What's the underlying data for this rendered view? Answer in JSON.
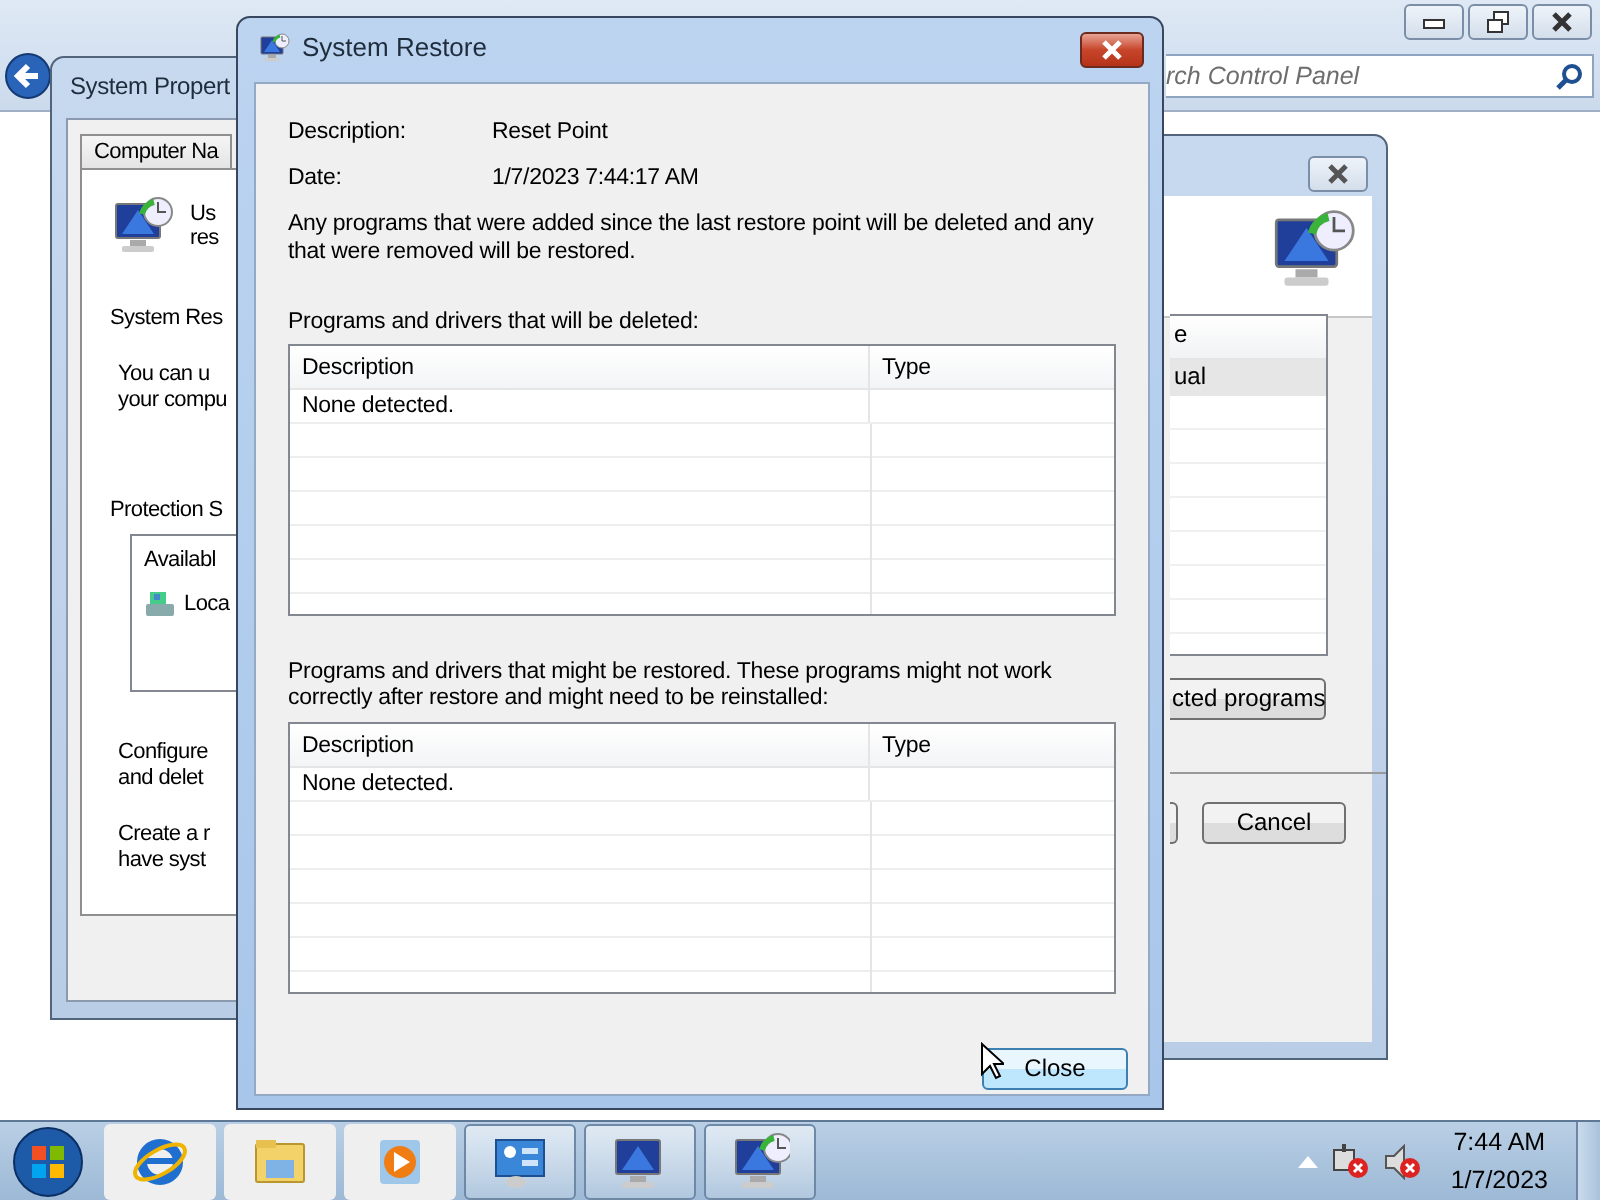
{
  "control_panel": {
    "search": {
      "placeholder": "rch Control Panel"
    }
  },
  "system_properties": {
    "title": "System Propert",
    "tab": "Computer Na",
    "intro": [
      "Us",
      "res"
    ],
    "heading": "System Res",
    "description": [
      "You can u",
      "your compu"
    ],
    "protection_heading": "Protection S",
    "list": {
      "column": "Availabl",
      "rows": [
        "Loca"
      ]
    },
    "configure": [
      "Configure",
      "and delet"
    ],
    "create": [
      "Create a r",
      "have syst"
    ]
  },
  "wizard": {
    "list": {
      "column": "e",
      "rows": [
        {
          "text": "ual",
          "selected": true
        }
      ]
    },
    "programs_button": "cted programs",
    "cancel_button": "Cancel"
  },
  "dialog": {
    "title": "System Restore",
    "fields": [
      {
        "label": "Description:",
        "value": "Reset Point"
      },
      {
        "label": "Date:",
        "value": "1/7/2023 7:44:17 AM"
      }
    ],
    "note": "Any programs that were added since the last restore point will be deleted and any that were removed will be restored.",
    "sections": [
      {
        "caption": "Programs and drivers that will be deleted:",
        "columns": [
          "Description",
          "Type"
        ],
        "rows": [
          {
            "description": "None detected."
          }
        ]
      },
      {
        "caption": "Programs and drivers that might be restored. These programs might not work correctly after restore and might need to be reinstalled:",
        "columns": [
          "Description",
          "Type"
        ],
        "rows": [
          {
            "description": "None detected."
          }
        ]
      }
    ],
    "close_button": "Close"
  },
  "taskbar": {
    "items": [
      {
        "kind": "ie",
        "open": false
      },
      {
        "kind": "explorer",
        "open": false
      },
      {
        "kind": "media",
        "open": false
      },
      {
        "kind": "control_panel",
        "open": true
      },
      {
        "kind": "system",
        "open": true
      },
      {
        "kind": "restore",
        "open": true
      }
    ],
    "tray": [
      {
        "kind": "network"
      },
      {
        "kind": "volume"
      }
    ],
    "clock": {
      "time": "7:44 AM",
      "date": "1/7/2023"
    }
  }
}
